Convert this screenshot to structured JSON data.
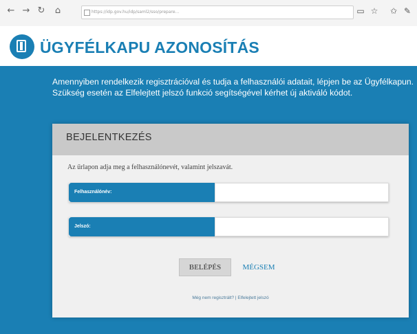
{
  "browser": {
    "url": "https://idp.gov.hu/idp/saml2/sso/prepare...",
    "nav": {
      "back": "←",
      "forward": "→",
      "refresh": "↻",
      "home": "⌂"
    },
    "tools": {
      "reader": "▭",
      "favorite": "☆",
      "favorites_hub": "✩",
      "share": "✎"
    }
  },
  "header": {
    "title": "ÜGYFÉLKAPU AZONOSÍTÁS"
  },
  "intro": {
    "text": "Amennyiben rendelkezik regisztrációval és tudja a felhasználói adatait, lépjen be az Ügyfélkapun. Szükség esetén az Elfelejtett jelszó funkció segítségével kérhet új aktiváló kódot."
  },
  "login": {
    "title": "BEJELENTKEZÉS",
    "instruction": "Az űrlapon adja meg a felhasználónevét, valamint jelszavát.",
    "username_label": "Felhasználónév:",
    "username_value": "",
    "password_label": "Jelszó:",
    "password_value": "",
    "login_button": "BELÉPÉS",
    "cancel_button": "MÉGSEM",
    "register_link": "Még nem regisztrált?",
    "separator": "|",
    "forgot_link": "Elfelejtett jelszó"
  },
  "colors": {
    "brand": "#1a7fb4",
    "card_head": "#c9c9c9",
    "card_body": "#f0f0f0"
  }
}
